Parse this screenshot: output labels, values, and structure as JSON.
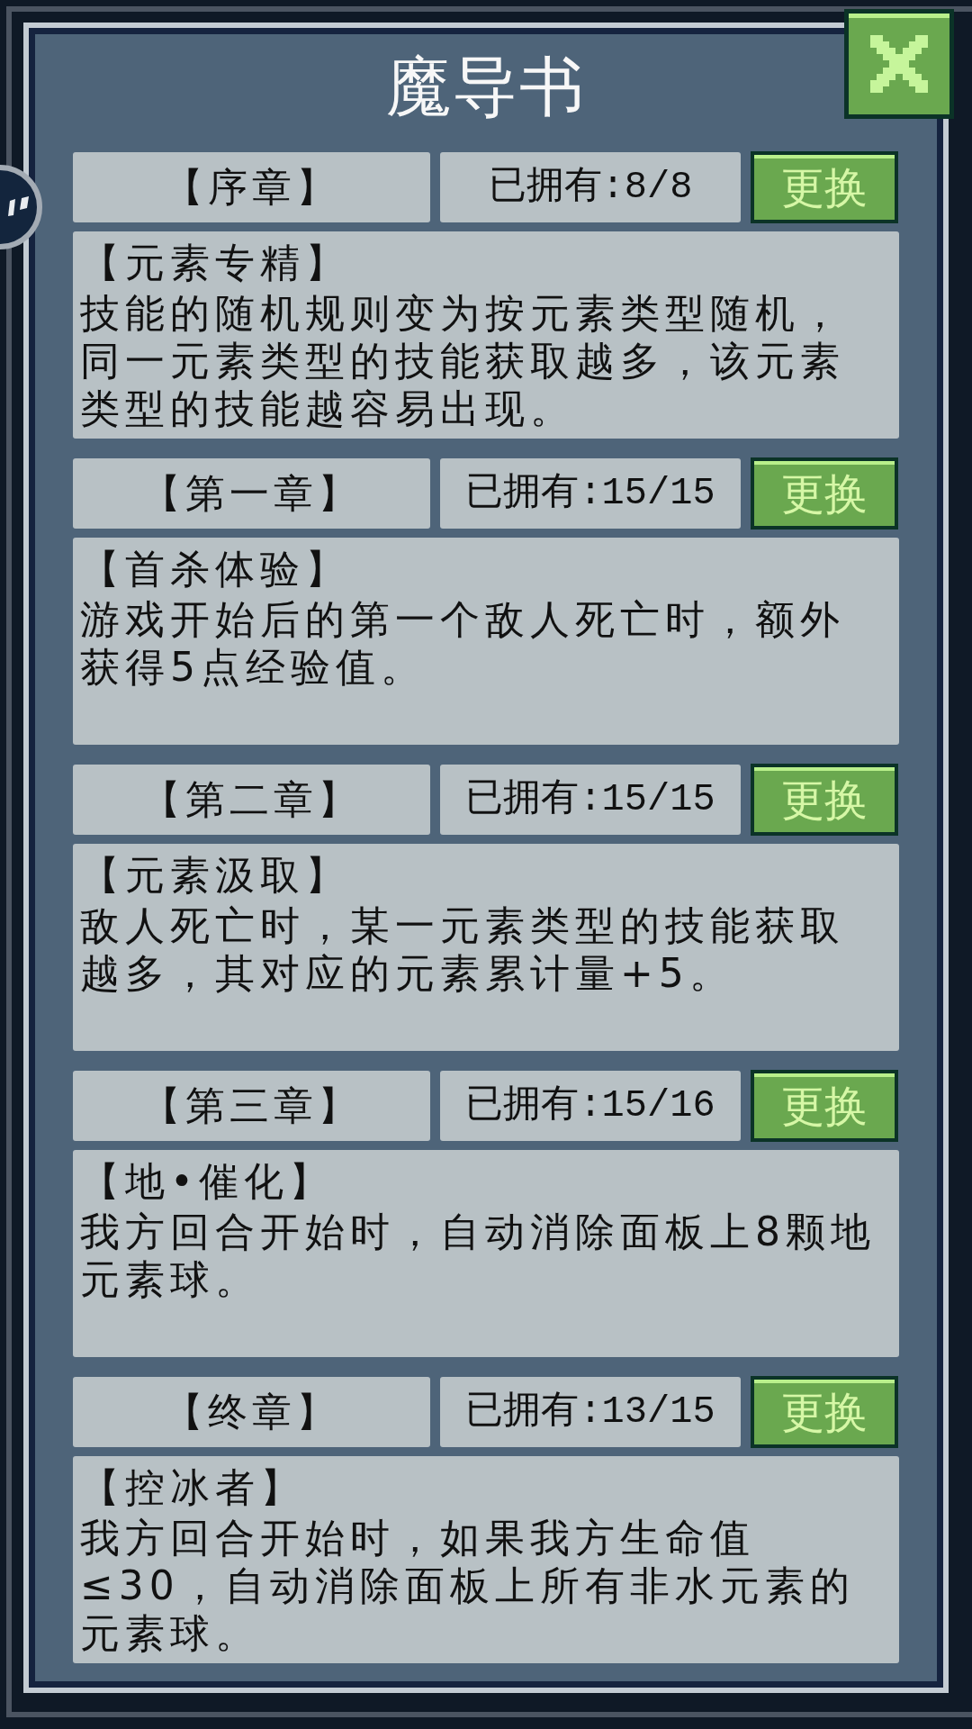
{
  "title": "魔导书",
  "chapters": [
    {
      "chapter": "【序章】",
      "owned": "已拥有:8/8",
      "button": "更换",
      "skill_name": "【元素专精】",
      "description": [
        "技能的随机规则变为按元素类型随机，",
        "同一元素类型的技能获取越多，该元素",
        "类型的技能越容易出现。"
      ]
    },
    {
      "chapter": "【第一章】",
      "owned": "已拥有:15/15",
      "button": "更换",
      "skill_name": "【首杀体验】",
      "description": [
        "游戏开始后的第一个敌人死亡时，额外",
        "获得5点经验值。"
      ]
    },
    {
      "chapter": "【第二章】",
      "owned": "已拥有:15/15",
      "button": "更换",
      "skill_name": "【元素汲取】",
      "description": [
        "敌人死亡时，某一元素类型的技能获取",
        "越多，其对应的元素累计量+5。"
      ]
    },
    {
      "chapter": "【第三章】",
      "owned": "已拥有:15/16",
      "button": "更换",
      "skill_name": "【地•催化】",
      "description": [
        "我方回合开始时，自动消除面板上8颗地",
        "元素球。"
      ]
    },
    {
      "chapter": "【终章】",
      "owned": "已拥有:13/15",
      "button": "更换",
      "skill_name": "【控冰者】",
      "description": [
        "我方回合开始时，如果我方生命值",
        "≤30，自动消除面板上所有非水元素的",
        "元素球。"
      ]
    }
  ]
}
